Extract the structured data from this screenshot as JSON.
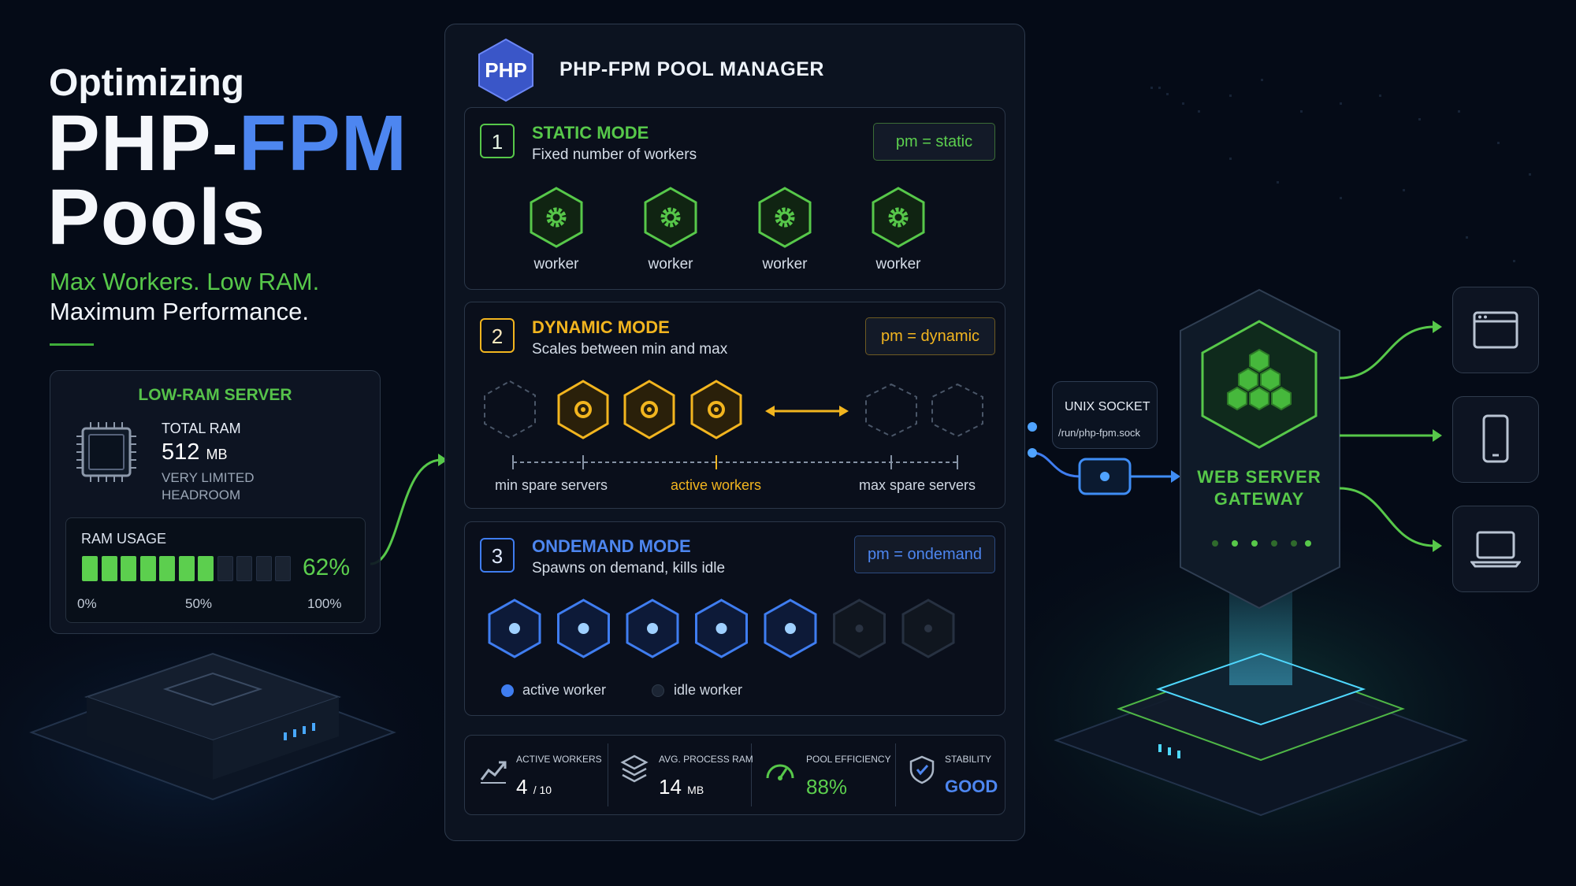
{
  "hero": {
    "pre": "Optimizing",
    "title_a": "PHP-",
    "title_b": "FPM",
    "title_c": "Pools",
    "tagline_1": "Max Workers. Low RAM.",
    "tagline_2": "Maximum Performance."
  },
  "server": {
    "title": "LOW-RAM SERVER",
    "total_ram_label": "TOTAL RAM",
    "total_ram_value": "512",
    "total_ram_unit": "MB",
    "note_1": "VERY LIMITED",
    "note_2": "HEADROOM",
    "usage_label": "RAM USAGE",
    "usage_percent": "62%",
    "usage_fraction": 0.62,
    "tick_0": "0%",
    "tick_50": "50%",
    "tick_100": "100%"
  },
  "manager": {
    "logo": "PHP",
    "title": "PHP-FPM POOL MANAGER",
    "static": {
      "num": "1",
      "title": "STATIC MODE",
      "desc": "Fixed number of workers",
      "pm": "pm = static",
      "workers": [
        "worker",
        "worker",
        "worker",
        "worker"
      ]
    },
    "dynamic": {
      "num": "2",
      "title": "DYNAMIC MODE",
      "desc": "Scales between min and max",
      "pm": "pm = dynamic",
      "min_label": "min spare servers",
      "active_label": "active workers",
      "max_label": "max spare servers"
    },
    "ondemand": {
      "num": "3",
      "title": "ONDEMAND MODE",
      "desc": "Spawns on demand, kills idle",
      "pm": "pm = ondemand",
      "legend_active": "active worker",
      "legend_idle": "idle worker",
      "active_count": 5,
      "idle_count": 2
    },
    "metrics": {
      "active_label": "ACTIVE WORKERS",
      "active_value": "4",
      "active_total": "/ 10",
      "ram_label": "AVG. PROCESS RAM",
      "ram_value": "14",
      "ram_unit": "MB",
      "eff_label": "POOL EFFICIENCY",
      "eff_value": "88%",
      "stab_label": "STABILITY",
      "stab_value": "GOOD"
    }
  },
  "socket": {
    "title": "UNIX SOCKET",
    "path": "/run/php-fpm.sock"
  },
  "gateway": {
    "line_1": "WEB SERVER",
    "line_2": "GATEWAY"
  },
  "colors": {
    "green": "#57c84a",
    "yellow": "#f2b51f",
    "blue": "#3f7df0",
    "background": "#050b17"
  }
}
